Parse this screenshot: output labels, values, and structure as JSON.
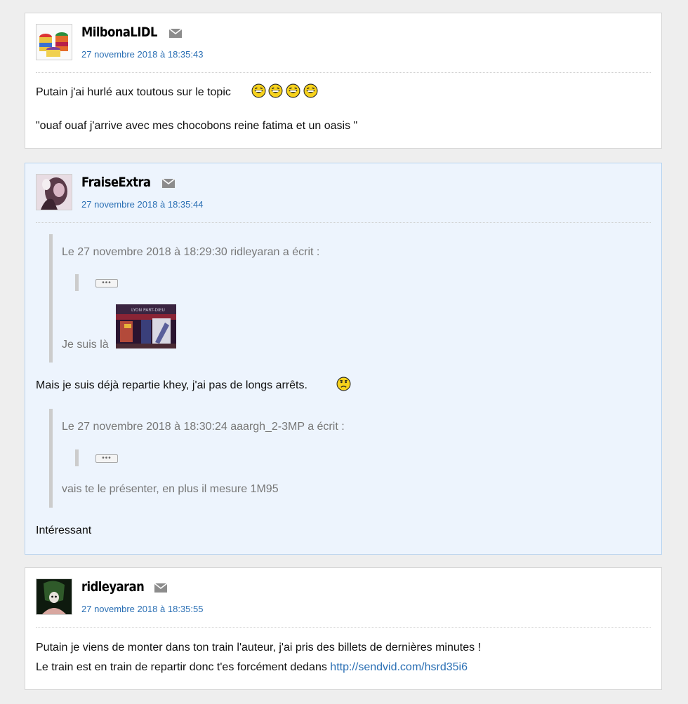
{
  "posts": [
    {
      "author": "MilbonaLIDL",
      "date": "27 novembre 2018 à 18:35:43",
      "lines": [
        "Putain j'ai hurlé aux toutous sur le topic",
        "\"ouaf ouaf j'arrive avec mes chocobons reine fatima et un oasis \""
      ],
      "smileys": [
        "rire-smiley",
        "rire-smiley",
        "rire-smiley",
        "rire-smiley"
      ]
    },
    {
      "author": "FraiseExtra",
      "date": "27 novembre 2018 à 18:35:44",
      "quote1": {
        "header": "Le 27 novembre 2018 à 18:29:30 ridleyaran a écrit :",
        "expand": "•••",
        "text": "Je suis là",
        "image_caption": "LYON PART-DIEU"
      },
      "reply1": "Mais je suis déjà repartie khey, j'ai pas de longs arrêts.",
      "reply1_smiley": "worried-smiley",
      "quote2": {
        "header": "Le 27 novembre 2018 à 18:30:24 aaargh_2-3MP a écrit :",
        "expand": "•••",
        "text": "vais te le présenter, en plus il mesure 1M95"
      },
      "reply2": "Intéressant"
    },
    {
      "author": "ridleyaran",
      "date": "27 novembre 2018 à 18:35:55",
      "line1": "Putain je viens de monter dans ton train l'auteur, j'ai pris des billets de dernières minutes !",
      "line2": "Le train est en train de repartir donc t'es forcément dedans",
      "link": "http://sendvid.com/hsrd35i6"
    }
  ],
  "colors": {
    "page_bg": "#eeeeee",
    "highlight_bg": "#edf4fd",
    "date_link": "#2a6fb4",
    "quote_text": "#777777"
  },
  "icons": [
    "envelope-icon",
    "rire-smiley",
    "worried-smiley"
  ]
}
